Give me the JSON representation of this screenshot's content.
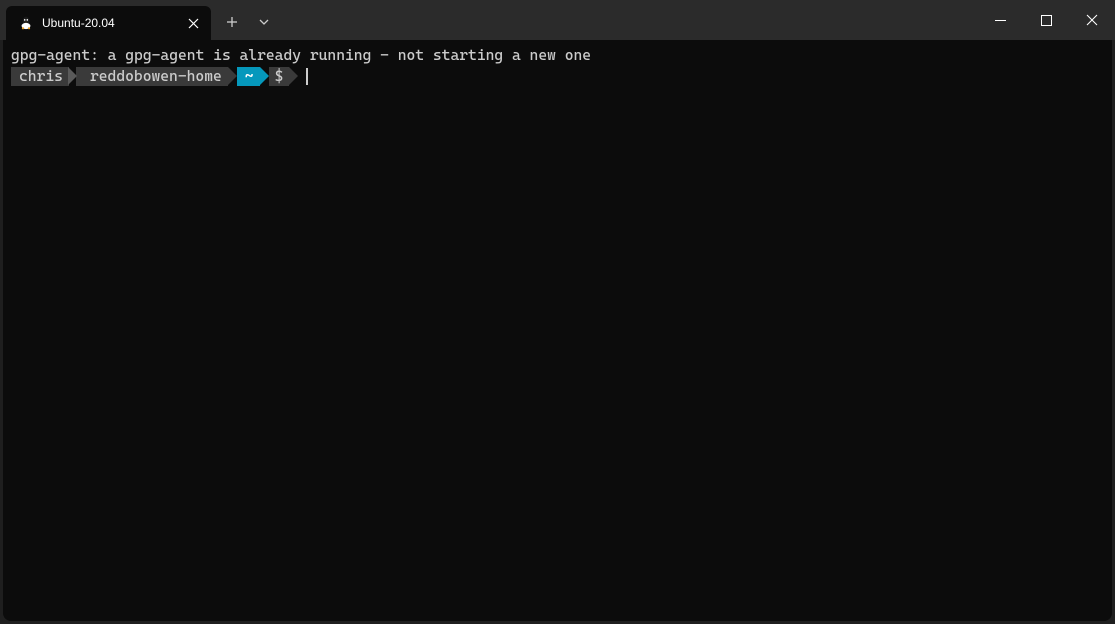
{
  "tab": {
    "title": "Ubuntu-20.04"
  },
  "terminal": {
    "output_line": "gpg-agent: a gpg-agent is already running - not starting a new one",
    "prompt": {
      "user": "chris",
      "host": "reddobowen-home",
      "dir": "~",
      "symbol": "$"
    }
  }
}
